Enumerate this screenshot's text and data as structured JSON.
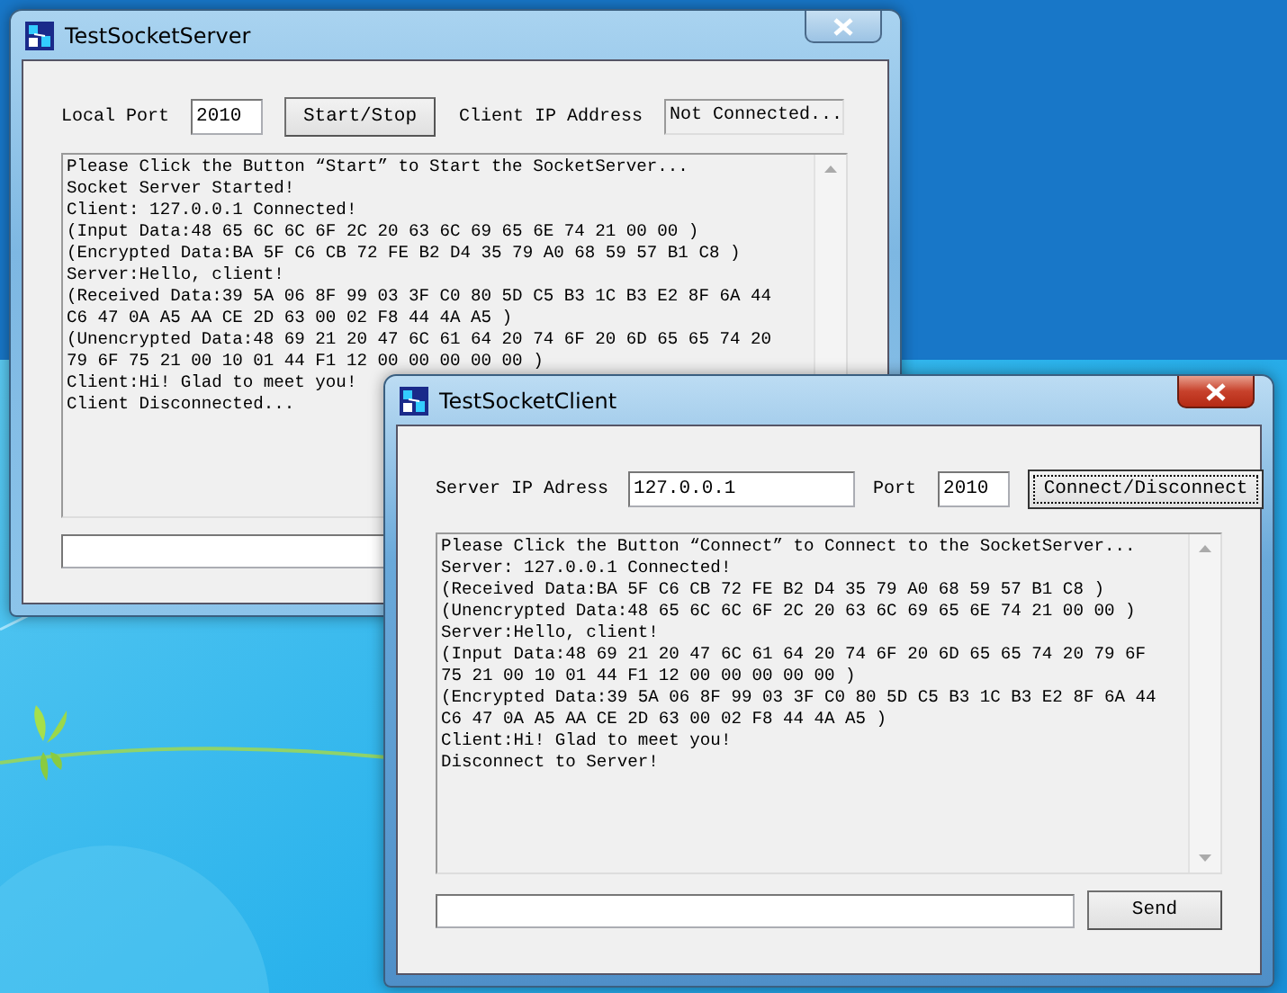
{
  "server_window": {
    "title": "TestSocketServer",
    "active": false,
    "local_port_label": "Local Port",
    "local_port": "2010",
    "start_button": {
      "label": "Start/Stop",
      "focused": false
    },
    "client_ip_label": "Client IP Address",
    "client_ip": "Not Connected...",
    "log": [
      "Please Click the Button “Start” to Start the SocketServer...",
      "Socket Server Started!",
      "Client: 127.0.0.1 Connected!",
      "(Input Data:48 65 6C 6C 6F 2C 20 63 6C 69 65 6E 74 21 00 00 )",
      "(Encrypted Data:BA 5F C6 CB 72 FE B2 D4 35 79 A0 68 59 57 B1 C8 )",
      "Server:Hello, client!",
      "(Received Data:39 5A 06 8F 99 03 3F C0 80 5D C5 B3 1C B3 E2 8F 6A 44",
      "C6 47 0A A5 AA CE 2D 63 00 02 F8 44 4A A5 )",
      "(Unencrypted Data:48 69 21 20 47 6C 61 64 20 74 6F 20 6D 65 65 74 20",
      "79 6F 75 21 00 10 01 44 F1 12 00 00 00 00 00 )",
      "Client:Hi! Glad to meet you!",
      "Client Disconnected..."
    ]
  },
  "client_window": {
    "title": "TestSocketClient",
    "active": true,
    "server_ip_label": "Server IP Adress",
    "server_ip": "127.0.0.1",
    "port_label": "Port",
    "port": "2010",
    "connect_button": {
      "label": "Connect/Disconnect",
      "focused": true
    },
    "log": [
      "Please Click the Button “Connect” to Connect to the SocketServer...",
      "Server: 127.0.0.1 Connected!",
      "(Received Data:BA 5F C6 CB 72 FE B2 D4 35 79 A0 68 59 57 B1 C8 )",
      "(Unencrypted Data:48 65 6C 6C 6F 2C 20 63 6C 69 65 6E 74 21 00 00 )",
      "Server:Hello, client!",
      "(Input Data:48 69 21 20 47 6C 61 64 20 74 6F 20 6D 65 65 74 20 79 6F",
      "75 21 00 10 01 44 F1 12 00 00 00 00 00 )",
      "(Encrypted Data:39 5A 06 8F 99 03 3F C0 80 5D C5 B3 1C B3 E2 8F 6A 44",
      "C6 47 0A A5 AA CE 2D 63 00 02 F8 44 4A A5 )",
      "Client:Hi! Glad to meet you!",
      "Disconnect to Server!"
    ],
    "send_button": "Send"
  }
}
